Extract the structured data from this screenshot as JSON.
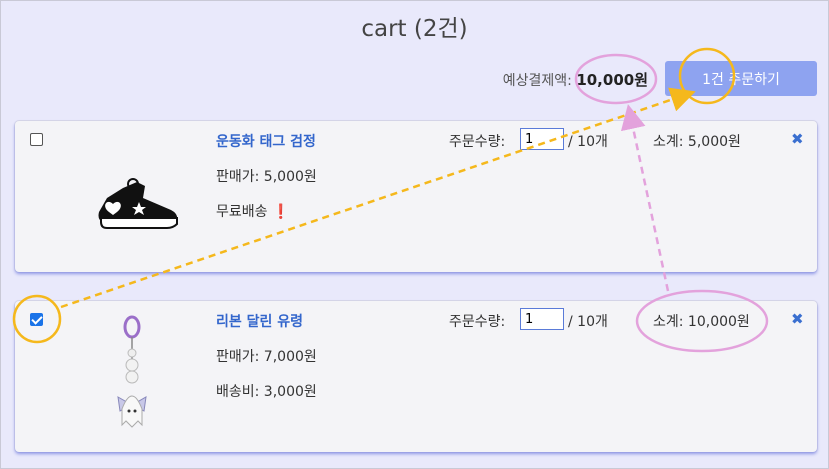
{
  "page": {
    "title": "cart (2건)"
  },
  "summary": {
    "label": "예상결제액:",
    "amount": "10,000원",
    "order_button": "1건 주문하기"
  },
  "items": [
    {
      "checked": false,
      "name": "운동화 태그 검정",
      "price": "판매가: 5,000원",
      "shipping": "무료배송",
      "shipping_mark": "❗",
      "qty_label": "주문수량:",
      "qty": "1",
      "qty_max": "/ 10개",
      "subtotal": "소계: 5,000원",
      "remove": "✖",
      "thumb_icon": "sneaker-keychain-icon"
    },
    {
      "checked": true,
      "name": "리본 달린 유령",
      "price": "판매가: 7,000원",
      "shipping": "배송비: 3,000원",
      "qty_label": "주문수량:",
      "qty": "1",
      "qty_max": "/ 10개",
      "subtotal": "소계: 10,000원",
      "remove": "✖",
      "thumb_icon": "ghost-keychain-icon"
    }
  ],
  "annotations": {
    "highlight_yellow": "#f5b81c",
    "highlight_pink": "#e3a2dc"
  }
}
